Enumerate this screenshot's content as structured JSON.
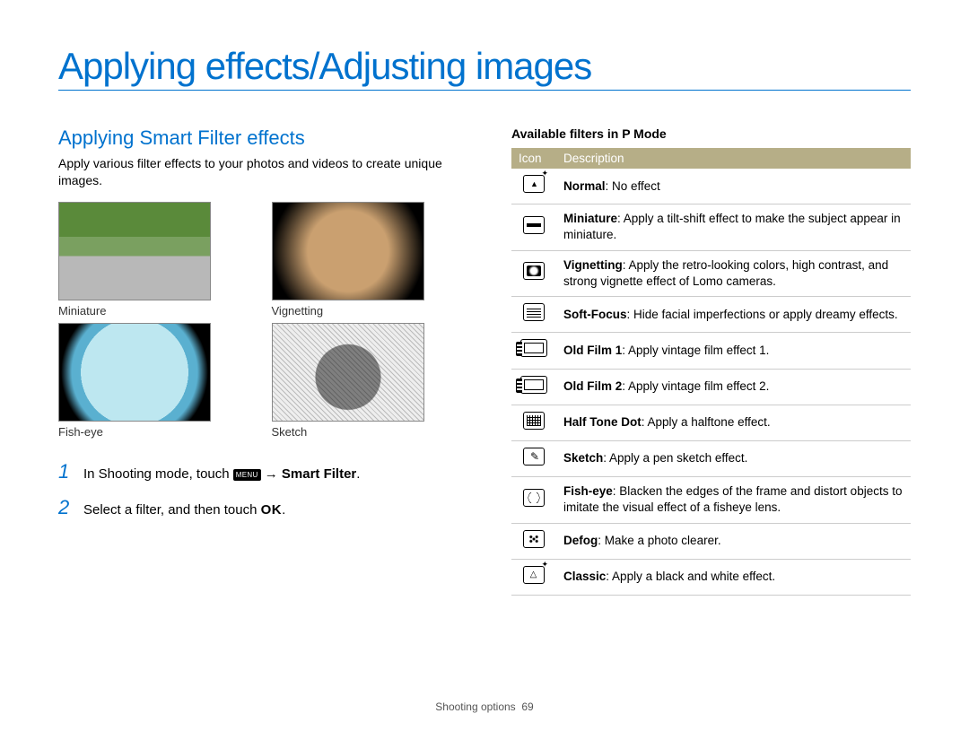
{
  "page_title": "Applying effects/Adjusting images",
  "section_title": "Applying Smart Filter effects",
  "section_intro": "Apply various filter effects to your photos and videos to create unique images.",
  "thumbs": [
    {
      "label": "Miniature",
      "class": "img-miniature"
    },
    {
      "label": "Vignetting",
      "class": "img-vignetting"
    },
    {
      "label": "Fish-eye",
      "class": "img-fisheye"
    },
    {
      "label": "Sketch",
      "class": "img-sketch"
    }
  ],
  "steps": {
    "s1_pre": "In Shooting mode, touch ",
    "menu_chip": "MENU",
    "s1_post_arrow": " → ",
    "s1_bold": "Smart Filter",
    "s1_end": ".",
    "s2_pre": "Select a filter, and then touch ",
    "ok": "OK",
    "s2_end": "."
  },
  "table_title": "Available filters in P Mode",
  "thead": {
    "c1": "Icon",
    "c2": "Description"
  },
  "filters": [
    {
      "icon": "ic-normal",
      "bold": "Normal",
      "sep": ": ",
      "desc": "No effect"
    },
    {
      "icon": "ic-mini",
      "bold": "Miniature",
      "sep": ": ",
      "desc": "Apply a tilt-shift effect to make the subject appear in miniature."
    },
    {
      "icon": "ic-vign",
      "bold": "Vignetting",
      "sep": ": ",
      "desc": "Apply the retro-looking colors, high contrast, and strong vignette effect of Lomo cameras."
    },
    {
      "icon": "ic-soft",
      "bold": "Soft-Focus",
      "sep": ": ",
      "desc": "Hide facial imperfections or apply dreamy effects."
    },
    {
      "icon": "ic-film1",
      "bold": "Old Film 1",
      "sep": ": ",
      "desc": "Apply vintage film effect 1."
    },
    {
      "icon": "ic-film2",
      "bold": "Old Film 2",
      "sep": ": ",
      "desc": "Apply vintage film effect 2."
    },
    {
      "icon": "ic-half",
      "bold": "Half Tone Dot",
      "sep": ": ",
      "desc": "Apply a halftone effect."
    },
    {
      "icon": "ic-sketch",
      "bold": "Sketch",
      "sep": ": ",
      "desc": "Apply a pen sketch effect."
    },
    {
      "icon": "ic-fish",
      "bold": "Fish-eye",
      "sep": ": ",
      "desc": "Blacken the edges of the frame and distort objects to imitate the visual effect of a fisheye lens."
    },
    {
      "icon": "ic-defog",
      "bold": "Defog",
      "sep": ": ",
      "desc": "Make a photo clearer."
    },
    {
      "icon": "ic-classic",
      "bold": "Classic",
      "sep": ": ",
      "desc": "Apply a black and white effect."
    }
  ],
  "footer": {
    "label": "Shooting options",
    "page": "69"
  }
}
